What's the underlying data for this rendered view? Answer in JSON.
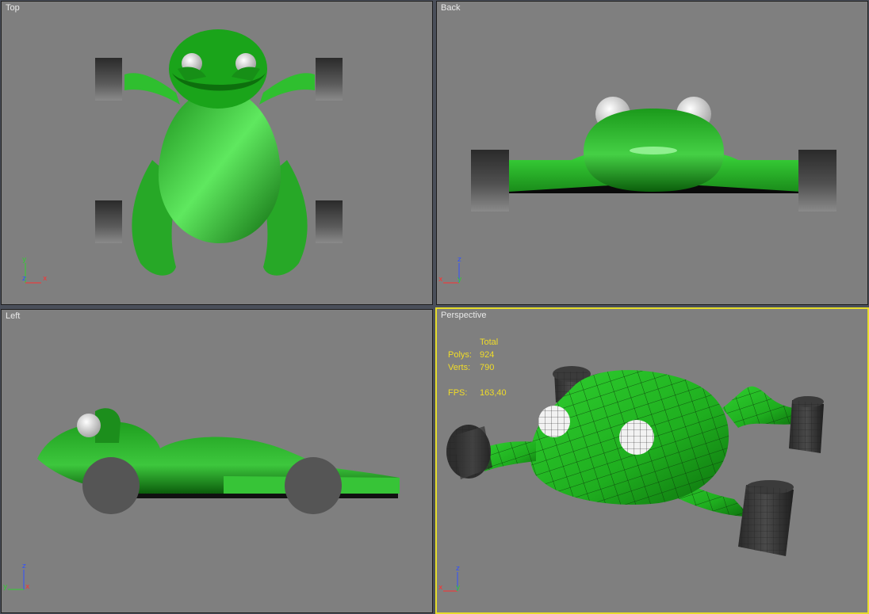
{
  "colors": {
    "viewport_bg": "#7f7f7f",
    "active_border": "#e6dc2c",
    "frog_green": "#22b522",
    "wheel_dark": "#3a3a3a",
    "stats_text": "#f0dc28",
    "axis_x": "#ff3030",
    "axis_y": "#30d030",
    "axis_z": "#3050ff"
  },
  "viewports": {
    "top": {
      "label": "Top",
      "axes": {
        "a": "y",
        "b": "x",
        "c": "z"
      }
    },
    "back": {
      "label": "Back",
      "axes": {
        "a": "z",
        "b": "x",
        "c": "y"
      }
    },
    "left": {
      "label": "Left",
      "axes": {
        "a": "z",
        "b": "x",
        "c": "y"
      }
    },
    "perspective": {
      "label": "Perspective",
      "axes": {
        "a": "z",
        "b": "x",
        "c": "y"
      }
    }
  },
  "stats": {
    "header": "Total",
    "polys_label": "Polys:",
    "polys_value": "924",
    "verts_label": "Verts:",
    "verts_value": "790",
    "fps_label": "FPS:",
    "fps_value": "163,40"
  }
}
